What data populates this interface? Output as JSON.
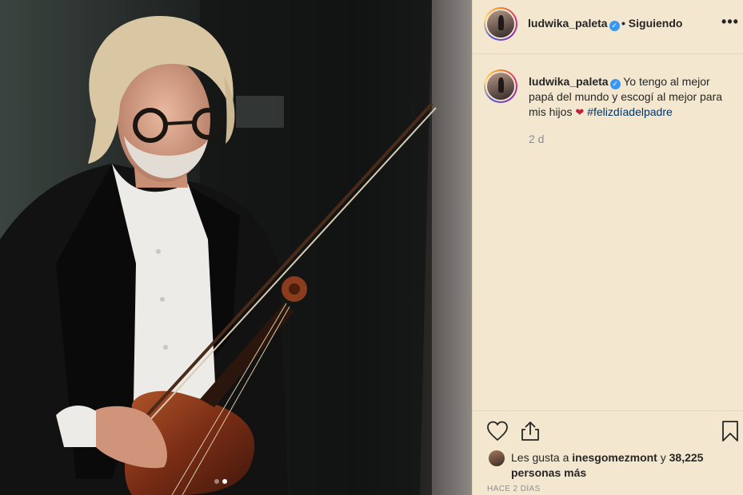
{
  "photo": {
    "description_icon": "photo",
    "carousel": {
      "total": 2,
      "active": 2
    }
  },
  "header": {
    "username": "ludwika_paleta",
    "separator": "•",
    "follow_status": "Siguiendo",
    "more_label": "•••"
  },
  "caption": {
    "username": "ludwika_paleta",
    "text": "Yo tengo al mejor papá del mundo y escogí al mejor para mis hijos",
    "emoji": "❤",
    "hashtag": "#felizdíadelpadre",
    "time": "2 d"
  },
  "likes": {
    "prefix": "Les gusta a",
    "liker": "inesgomezmont",
    "connector": "y",
    "count_text": "38,225 personas más"
  },
  "post_date": "HACE 2 DÍAS",
  "colors": {
    "panel_bg": "#f4e7cf",
    "verified": "#3897f0",
    "hashtag": "#003569",
    "muted": "#8e8e8e"
  }
}
